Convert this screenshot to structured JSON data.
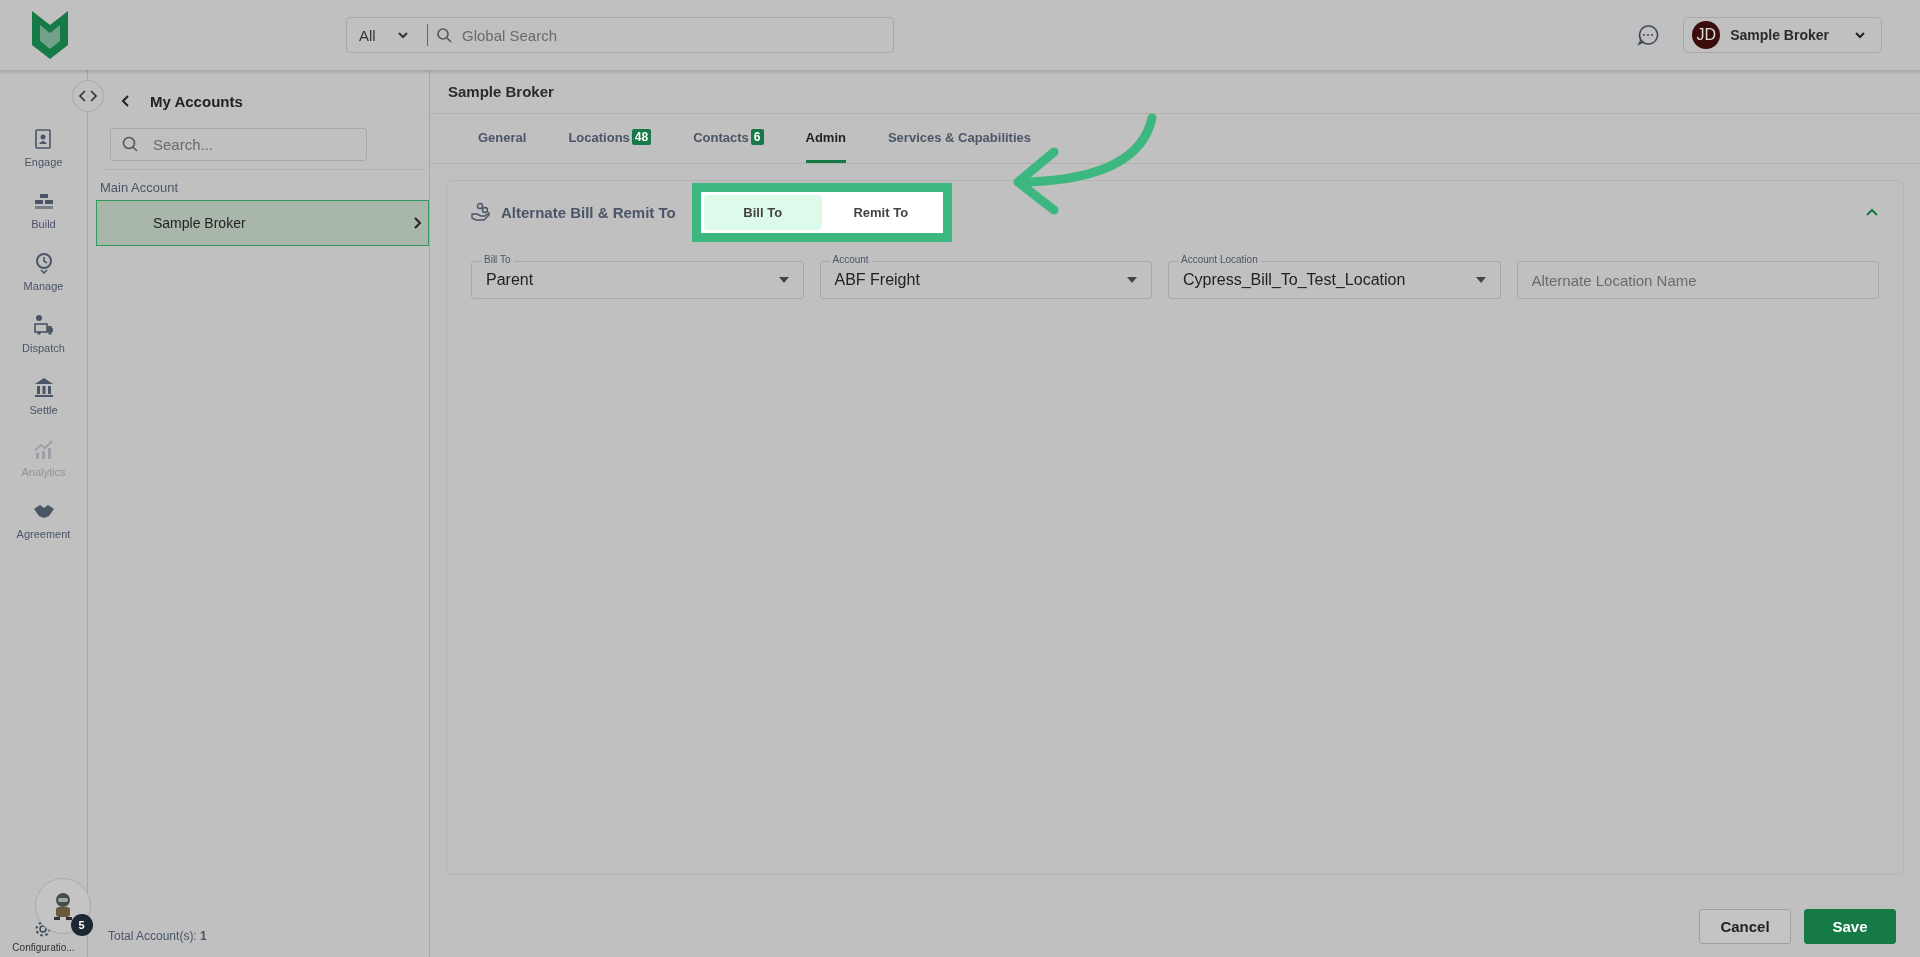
{
  "header": {
    "search_scope": "All",
    "search_placeholder": "Global Search",
    "user": {
      "initials": "JD",
      "name": "Sample Broker"
    }
  },
  "nav": [
    {
      "label": "Engage",
      "disabled": false
    },
    {
      "label": "Build",
      "disabled": false
    },
    {
      "label": "Manage",
      "disabled": false
    },
    {
      "label": "Dispatch",
      "disabled": false
    },
    {
      "label": "Settle",
      "disabled": false
    },
    {
      "label": "Analytics",
      "disabled": true
    },
    {
      "label": "Agreement",
      "disabled": false
    }
  ],
  "config": {
    "label": "Configuratio...",
    "badge": "5"
  },
  "accounts": {
    "title": "My Accounts",
    "search_placeholder": "Search...",
    "group": "Main Account",
    "items": [
      {
        "name": "Sample Broker",
        "selected": true
      }
    ],
    "total": "Total Account(s): **1**"
  },
  "page": {
    "title": "Sample Broker",
    "tabs": [
      {
        "label": "General",
        "selected": false
      },
      {
        "label": "Locations",
        "badge": "48",
        "selected": false
      },
      {
        "label": "Contacts",
        "badge": "6",
        "selected": false
      },
      {
        "label": "Admin",
        "selected": true
      },
      {
        "label": "Services & Capabilities",
        "selected": false
      }
    ]
  },
  "section": {
    "title": "Alternate Bill & Remit To",
    "expanded": true,
    "segments": [
      {
        "label": "Bill To",
        "selected": true
      },
      {
        "label": "Remit To",
        "selected": false
      }
    ],
    "fields": [
      {
        "kind": "select",
        "label": "Bill To",
        "value": "Parent"
      },
      {
        "kind": "select",
        "label": "Account",
        "value": "ABF Freight"
      },
      {
        "kind": "select",
        "label": "Account Location",
        "value": "Cypress_Bill_To_Test_Location"
      },
      {
        "kind": "text",
        "placeholder": "Alternate Location Name"
      }
    ]
  },
  "buttons": [
    {
      "label": "Cancel",
      "kind": "secondary"
    },
    {
      "label": "Save",
      "kind": "primary"
    }
  ]
}
